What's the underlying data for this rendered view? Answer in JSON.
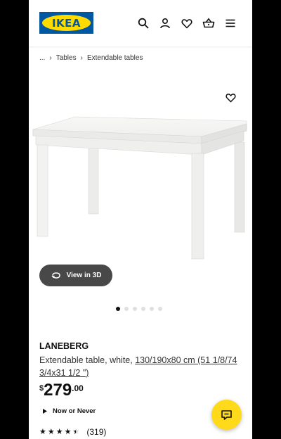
{
  "header": {
    "logo_text": "IKEA",
    "icons": [
      "search-icon",
      "user-icon",
      "heart-icon",
      "basket-icon",
      "menu-icon"
    ]
  },
  "breadcrumb": {
    "ellipsis": "...",
    "items": [
      "Tables",
      "Extendable tables"
    ]
  },
  "gallery": {
    "view_in_3d_label": "View in 3D",
    "image_count": 6,
    "active_index": 0
  },
  "product": {
    "name": "LANEBERG",
    "description_prefix": "Extendable table, white, ",
    "dimensions": "130/190x80 cm (51 1/8/74 3/4x31 1/2 \")",
    "price": {
      "currency": "$",
      "integer": "279",
      "decimal": ".00"
    },
    "availability_label": "Now or Never",
    "rating": 4.5,
    "review_count": "(319)"
  },
  "colors": {
    "ikea_blue": "#0058a3",
    "ikea_yellow": "#ffdb00",
    "chat_yellow": "#ffda1a",
    "pill_dark": "#484848"
  }
}
